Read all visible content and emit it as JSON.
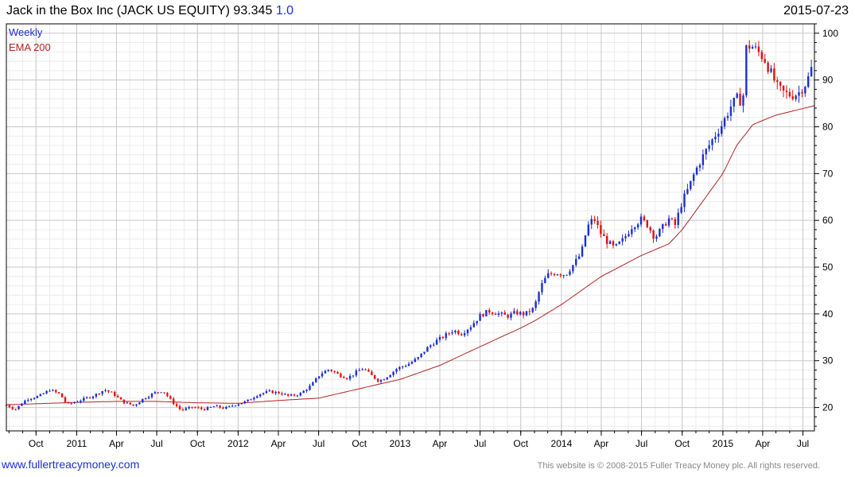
{
  "header": {
    "title": "Jack in the Box Inc (JACK US EQUITY) 93.345",
    "change": "1.0",
    "date": "2015-07-23"
  },
  "footer": {
    "site": "www.fullertreacymoney.com",
    "copyright": "This website is © 2008-2015 Fuller Treacy Money plc. All rights reserved."
  },
  "colors": {
    "up": "#1a2fd0",
    "down": "#e01010",
    "ema": "#b22222",
    "grid": "#dcdcdc",
    "frame": "#000000"
  },
  "chart_data": {
    "type": "candlestick",
    "legend": [
      {
        "label": "Weekly",
        "color": "#1a2fd0"
      },
      {
        "label": "EMA 200",
        "color": "#b22222"
      }
    ],
    "ylim": [
      15,
      102
    ],
    "y_ticks": [
      20,
      30,
      40,
      50,
      60,
      70,
      80,
      90,
      100
    ],
    "x_range": [
      "2010-07-26",
      "2015-07-27"
    ],
    "x_ticks": [
      {
        "label": "Oct",
        "date": "2010-10-01"
      },
      {
        "label": "2011",
        "date": "2011-01-01"
      },
      {
        "label": "Apr",
        "date": "2011-04-01"
      },
      {
        "label": "Jul",
        "date": "2011-07-01"
      },
      {
        "label": "Oct",
        "date": "2011-10-01"
      },
      {
        "label": "2012",
        "date": "2012-01-01"
      },
      {
        "label": "Apr",
        "date": "2012-04-01"
      },
      {
        "label": "Jul",
        "date": "2012-07-01"
      },
      {
        "label": "Oct",
        "date": "2012-10-01"
      },
      {
        "label": "2013",
        "date": "2013-01-01"
      },
      {
        "label": "Apr",
        "date": "2013-04-01"
      },
      {
        "label": "Jul",
        "date": "2013-07-01"
      },
      {
        "label": "Oct",
        "date": "2013-10-01"
      },
      {
        "label": "2014",
        "date": "2014-01-01"
      },
      {
        "label": "Apr",
        "date": "2014-04-01"
      },
      {
        "label": "Jul",
        "date": "2014-07-01"
      },
      {
        "label": "Oct",
        "date": "2014-10-01"
      },
      {
        "label": "2015",
        "date": "2015-01-01"
      },
      {
        "label": "Apr",
        "date": "2015-04-01"
      },
      {
        "label": "Jul",
        "date": "2015-07-01"
      }
    ],
    "close_series": [
      [
        "2010-07-26",
        20.5
      ],
      [
        "2010-08-15",
        19.6
      ],
      [
        "2010-09-10",
        21.8
      ],
      [
        "2010-10-10",
        22.5
      ],
      [
        "2010-11-01",
        23.8
      ],
      [
        "2010-11-25",
        22.8
      ],
      [
        "2010-12-10",
        20.6
      ],
      [
        "2011-01-05",
        21.4
      ],
      [
        "2011-02-10",
        22.6
      ],
      [
        "2011-03-05",
        23.8
      ],
      [
        "2011-03-25",
        22.9
      ],
      [
        "2011-04-15",
        21.2
      ],
      [
        "2011-05-10",
        20.4
      ],
      [
        "2011-06-01",
        21.9
      ],
      [
        "2011-06-25",
        23.1
      ],
      [
        "2011-07-15",
        23.6
      ],
      [
        "2011-08-05",
        21.2
      ],
      [
        "2011-08-25",
        19.4
      ],
      [
        "2011-09-20",
        20.1
      ],
      [
        "2011-10-15",
        19.6
      ],
      [
        "2011-11-10",
        20.3
      ],
      [
        "2011-12-01",
        19.8
      ],
      [
        "2011-12-25",
        20.6
      ],
      [
        "2012-01-20",
        21.3
      ],
      [
        "2012-02-15",
        22.8
      ],
      [
        "2012-03-10",
        23.4
      ],
      [
        "2012-04-05",
        23.1
      ],
      [
        "2012-04-25",
        22.4
      ],
      [
        "2012-05-20",
        22.9
      ],
      [
        "2012-06-15",
        24.8
      ],
      [
        "2012-07-05",
        27.2
      ],
      [
        "2012-07-25",
        28.2
      ],
      [
        "2012-08-15",
        27.0
      ],
      [
        "2012-09-05",
        26.3
      ],
      [
        "2012-09-25",
        27.6
      ],
      [
        "2012-10-10",
        28.4
      ],
      [
        "2012-10-25",
        27.1
      ],
      [
        "2012-11-15",
        25.6
      ],
      [
        "2012-12-05",
        26.8
      ],
      [
        "2012-12-25",
        28.3
      ],
      [
        "2013-01-20",
        29.3
      ],
      [
        "2013-02-10",
        30.5
      ],
      [
        "2013-03-01",
        32.5
      ],
      [
        "2013-03-20",
        34.0
      ],
      [
        "2013-04-10",
        35.2
      ],
      [
        "2013-05-01",
        36.5
      ],
      [
        "2013-05-20",
        35.8
      ],
      [
        "2013-06-10",
        37.4
      ],
      [
        "2013-07-01",
        39.6
      ],
      [
        "2013-07-20",
        40.6
      ],
      [
        "2013-08-10",
        40.1
      ],
      [
        "2013-09-01",
        39.5
      ],
      [
        "2013-09-20",
        40.3
      ],
      [
        "2013-10-10",
        39.9
      ],
      [
        "2013-10-31",
        41.2
      ],
      [
        "2013-11-15",
        45.8
      ],
      [
        "2013-11-30",
        48.3
      ],
      [
        "2013-12-20",
        48.8
      ],
      [
        "2014-01-10",
        48.4
      ],
      [
        "2014-01-31",
        50.9
      ],
      [
        "2014-02-15",
        53.0
      ],
      [
        "2014-02-28",
        58.5
      ],
      [
        "2014-03-15",
        60.5
      ],
      [
        "2014-03-31",
        57.2
      ],
      [
        "2014-04-15",
        55.4
      ],
      [
        "2014-05-01",
        54.0
      ],
      [
        "2014-05-20",
        55.8
      ],
      [
        "2014-06-10",
        58.8
      ],
      [
        "2014-06-30",
        60.2
      ],
      [
        "2014-07-15",
        59.0
      ],
      [
        "2014-07-31",
        56.3
      ],
      [
        "2014-08-15",
        58.1
      ],
      [
        "2014-08-31",
        60.4
      ],
      [
        "2014-09-15",
        59.0
      ],
      [
        "2014-09-30",
        63.8
      ],
      [
        "2014-10-15",
        66.8
      ],
      [
        "2014-10-31",
        70.6
      ],
      [
        "2014-11-15",
        73.4
      ],
      [
        "2014-11-30",
        75.9
      ],
      [
        "2014-12-15",
        78.3
      ],
      [
        "2014-12-31",
        80.6
      ],
      [
        "2015-01-20",
        84.6
      ],
      [
        "2015-02-05",
        86.4
      ],
      [
        "2015-02-15",
        84.3
      ],
      [
        "2015-02-20",
        96.6
      ],
      [
        "2015-03-05",
        97.4
      ],
      [
        "2015-03-20",
        96.2
      ],
      [
        "2015-04-05",
        94.5
      ],
      [
        "2015-04-20",
        91.4
      ],
      [
        "2015-05-05",
        88.3
      ],
      [
        "2015-05-20",
        87.2
      ],
      [
        "2015-06-05",
        86.7
      ],
      [
        "2015-06-20",
        87.1
      ],
      [
        "2015-07-10",
        89.6
      ],
      [
        "2015-07-23",
        93.3
      ]
    ],
    "ema200_series": [
      [
        "2010-07-26",
        20.6
      ],
      [
        "2010-10-01",
        20.8
      ],
      [
        "2011-01-01",
        21.1
      ],
      [
        "2011-04-01",
        21.3
      ],
      [
        "2011-07-01",
        21.3
      ],
      [
        "2011-10-01",
        21.0
      ],
      [
        "2012-01-01",
        20.9
      ],
      [
        "2012-04-01",
        21.5
      ],
      [
        "2012-07-01",
        22.0
      ],
      [
        "2012-10-01",
        24.0
      ],
      [
        "2012-11-15",
        25.0
      ],
      [
        "2013-01-01",
        26.0
      ],
      [
        "2013-04-01",
        29.0
      ],
      [
        "2013-07-01",
        33.0
      ],
      [
        "2013-10-01",
        37.0
      ],
      [
        "2013-11-01",
        38.5
      ],
      [
        "2014-01-01",
        42.0
      ],
      [
        "2014-04-01",
        48.0
      ],
      [
        "2014-07-01",
        52.5
      ],
      [
        "2014-09-01",
        55.0
      ],
      [
        "2014-10-01",
        58.0
      ],
      [
        "2015-01-01",
        70.0
      ],
      [
        "2015-02-01",
        76.0
      ],
      [
        "2015-03-10",
        80.5
      ],
      [
        "2015-05-01",
        82.5
      ],
      [
        "2015-07-27",
        84.5
      ]
    ]
  }
}
